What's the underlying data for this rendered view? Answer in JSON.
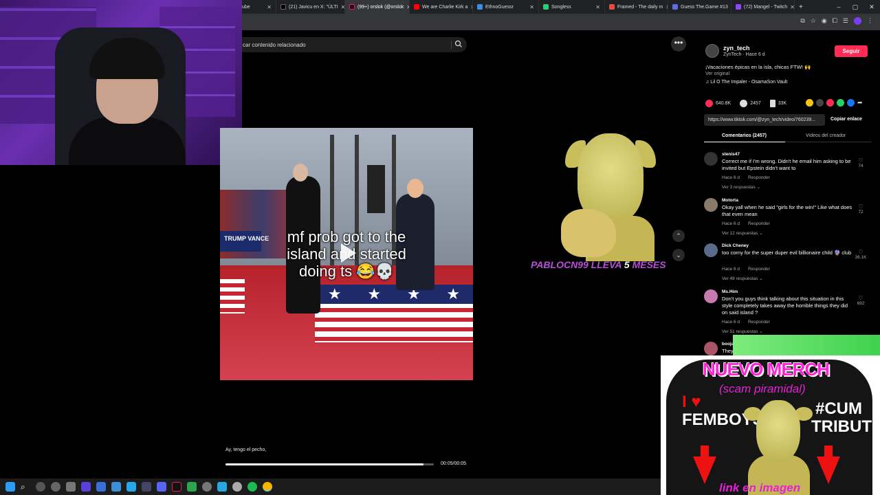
{
  "browser": {
    "tabs": [
      {
        "title": "ube",
        "color": "#ff0000",
        "active": false
      },
      {
        "title": "(21) Javicu en X: \"ÚLTI",
        "color": "#000000",
        "active": false
      },
      {
        "title": "(99+) orslok (@orslok",
        "color": "#111111",
        "active": true
      },
      {
        "title": "We are Charlie Kirk a",
        "color": "#ff0000",
        "active": false
      },
      {
        "title": "EthnoGuessr",
        "color": "#3a8ee6",
        "active": false
      },
      {
        "title": "Songless",
        "color": "#2ecc71",
        "active": false
      },
      {
        "title": "Framed - The daily m",
        "color": "#e74c3c",
        "active": false
      },
      {
        "title": "Guess The.Game #13",
        "color": "#5b6ee1",
        "active": false
      },
      {
        "title": "(72) Mangel - Twitch",
        "color": "#9146ff",
        "active": false
      }
    ],
    "new_tab": "+",
    "window_controls": {
      "minimize": "–",
      "maximize": "▢",
      "close": "✕"
    }
  },
  "search": {
    "placeholder": "car contenido relacionado"
  },
  "video": {
    "caption_line1": "mf prob got to the",
    "caption_line2": "island and started",
    "caption_line3": "doing ts 😂💀",
    "banner_text": "TRUMP VANCE",
    "subtitle": "Ay, tengo el pecho,",
    "progress": 0.95,
    "time": "00:05/00:05"
  },
  "overlay": {
    "goblin_text_purple": "PABLOCN99 LLEVA",
    "goblin_text_white": "5",
    "goblin_text_purple2": "MESES"
  },
  "sidebar": {
    "more": "•••",
    "creator": {
      "name": "zyn_tech",
      "subtitle": "ZynTech · Hace 6 d",
      "follow": "Seguir"
    },
    "description": "¡Vacaciones épicas en la isla, chicas FTW! 🙌",
    "ver_original": "Ver original",
    "music": "♫  Lil O The Impaler - OsamaSon Vault",
    "actions": {
      "likes": "640.8K",
      "comments": "2457",
      "saves": "33K"
    },
    "link": "https://www.tiktok.com/@zyn_tech/video/760239...",
    "copy_link": "Copiar enlace",
    "tab_comments": "Comentarios (2457)",
    "tab_videos": "Videos del creador",
    "comments": [
      {
        "name": "stenis47",
        "text": "Correct me if I'm wrong. Didn't he email him asking to be invited but Epstein didn't want to",
        "time": "Hace 6 d",
        "reply": "Responder",
        "replies": "Ver 3 respuestas ⌄",
        "likes": "74",
        "color": "#333333"
      },
      {
        "name": "Motorta",
        "text": "Okay yall when he said \"girls for the win!\" Like what does that even mean",
        "time": "Hace 6 d",
        "reply": "Responder",
        "replies": "Ver 12 respuestas ⌄",
        "likes": "72",
        "color": "#8a7a6a"
      },
      {
        "name": "Dick Cheney",
        "text": "too corny for the super duper evil billionaire child 🔮 club",
        "time": "Hace 6 d",
        "reply": "Responder",
        "replies": "Ver 48 respuestas ⌄",
        "likes": "36.1K",
        "color": "#5a6a8a"
      },
      {
        "name": "Ms.Him",
        "text": "Don't you guys think talking about this situation in this style completely takes away the horrible things they did on said island ?",
        "time": "Hace 6 d",
        "reply": "Responder",
        "replies": "Ver 51 respuestas ⌄",
        "likes": "692",
        "color": "#c77ab0"
      }
    ],
    "partial_comment": {
      "name": "booja",
      "text": "They"
    }
  },
  "merch": {
    "title": "NUEVO MERCH",
    "subtitle": "(scam piramidal)",
    "left_love": "I ♥",
    "left_text": "FEMBOYS",
    "right_text": "#CUM TRIBUTE",
    "link": "link en imagen"
  },
  "colors": {
    "accent": "#fe2c55",
    "merch_pink": "#ff22d6",
    "overlay_purple": "#b84fd8"
  }
}
